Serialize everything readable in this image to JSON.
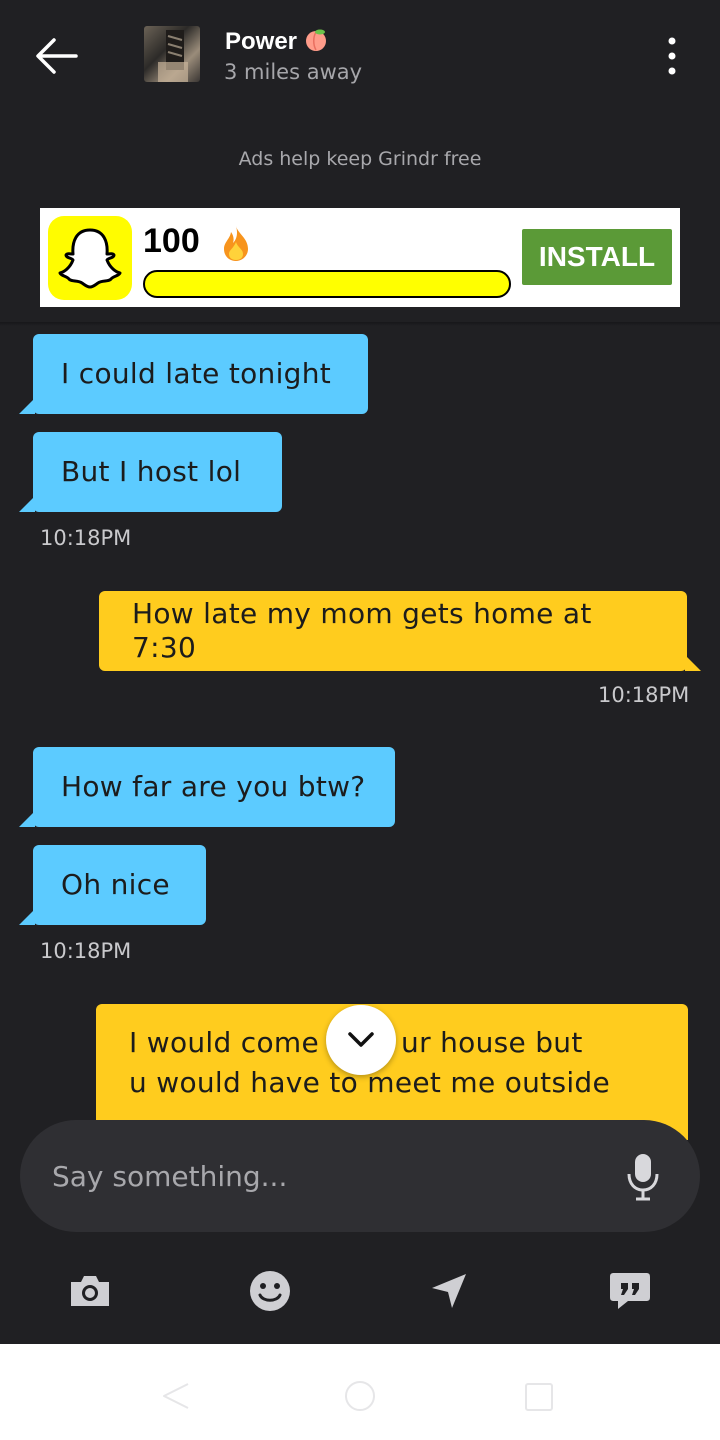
{
  "header": {
    "contact_name": "Power",
    "contact_emoji": "peach-emoji",
    "distance": "3 miles away"
  },
  "ads": {
    "note": "Ads help keep Grindr free",
    "count": "100",
    "install_label": "INSTALL",
    "brand_color": "#fffc00",
    "install_color": "#5b9a37"
  },
  "messages": [
    {
      "direction": "in",
      "text": "I could late tonight"
    },
    {
      "direction": "in",
      "text": "But I host lol",
      "time": "10:18PM"
    },
    {
      "direction": "out",
      "text": "How late my mom gets home at 7:30",
      "time": "10:18PM"
    },
    {
      "direction": "in",
      "text": "How far are you btw?"
    },
    {
      "direction": "in",
      "text": "Oh nice",
      "time": "10:18PM"
    },
    {
      "direction": "out",
      "line1": "I would come",
      "line1b": "ur house but",
      "line2": "u would have to meet me outside"
    }
  ],
  "composer": {
    "placeholder": "Say something..."
  },
  "colors": {
    "incoming_bubble": "#5ccbff",
    "outgoing_bubble": "#ffcc1e",
    "background": "#202023"
  }
}
